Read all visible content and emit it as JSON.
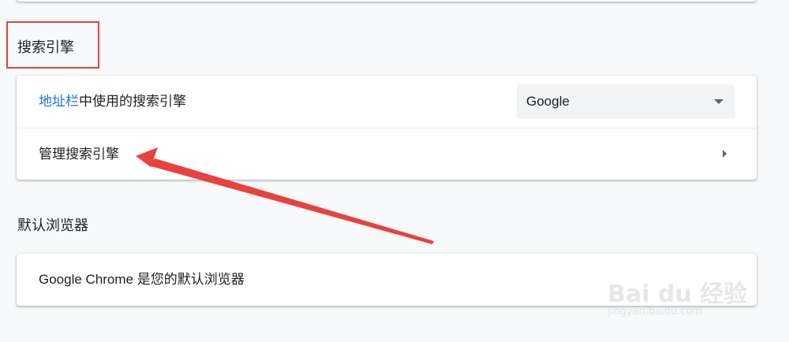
{
  "search_engine_section": {
    "title": "搜索引擎",
    "address_bar_row": {
      "label_link": "地址栏",
      "label_rest": "中使用的搜索引擎",
      "selected_engine": "Google"
    },
    "manage_row": {
      "label": "管理搜索引擎"
    }
  },
  "default_browser_section": {
    "title": "默认浏览器",
    "status_text": "Google Chrome 是您的默认浏览器"
  },
  "colors": {
    "link": "#1a73e8",
    "annotation_red": "#e8413e",
    "background": "#f8f9fa"
  },
  "watermark": {
    "text": "Bai du 经验",
    "sub": "jingyan.baidu.com"
  }
}
